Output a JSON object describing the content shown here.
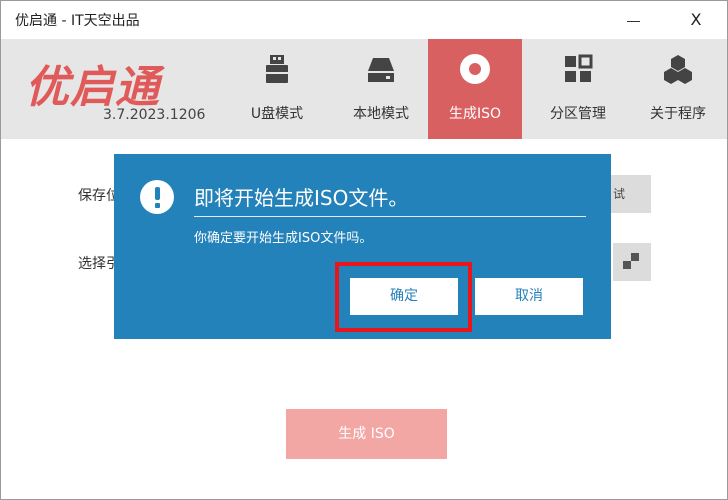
{
  "window": {
    "title": "优启通 - IT天空出品",
    "minimize": "",
    "close": "X"
  },
  "header": {
    "logo": "优启通",
    "version": "3.7.2023.1206",
    "nav": [
      {
        "label": "U盘模式",
        "icon": "usb-drive-icon"
      },
      {
        "label": "本地模式",
        "icon": "hard-drive-icon"
      },
      {
        "label": "生成ISO",
        "icon": "disc-icon",
        "active": true
      },
      {
        "label": "分区管理",
        "icon": "grid-icon"
      },
      {
        "label": "关于程序",
        "icon": "cubes-icon"
      }
    ]
  },
  "main": {
    "save_label_partial": "保存位",
    "select_label_partial": "选择引",
    "side_btn_1": "试",
    "generate_button": "生成 ISO"
  },
  "dialog": {
    "title": "即将开始生成ISO文件。",
    "message": "你确定要开始生成ISO文件吗。",
    "ok": "确定",
    "cancel": "取消"
  },
  "colors": {
    "accent": "#d96060",
    "dialog_bg": "#2482ba",
    "highlight": "#e8151b",
    "header_bg": "#e6e6e6"
  }
}
